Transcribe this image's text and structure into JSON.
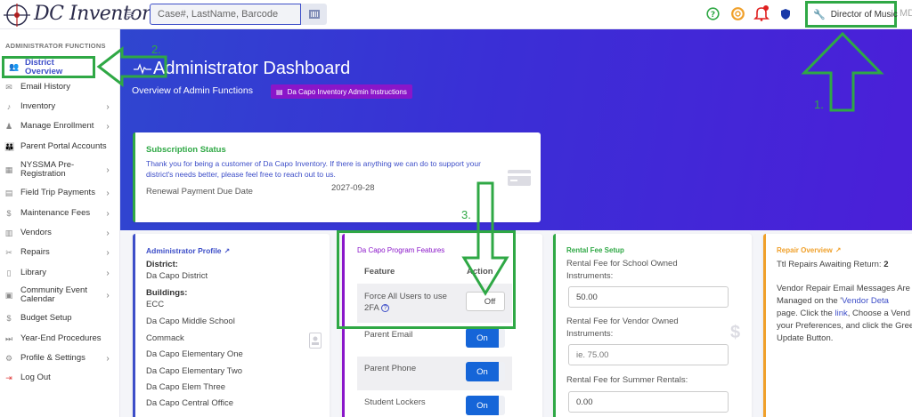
{
  "app": {
    "logo_text": "DC Inventory",
    "search_placeholder": "Case#, LastName, Barcode",
    "role": "Director of Music",
    "user_initials": "MD"
  },
  "sidebar": {
    "heading": "ADMINISTRATOR FUNCTIONS",
    "items": [
      {
        "label": "District Overview",
        "icon": "user-group-icon",
        "chevron": false,
        "active": true
      },
      {
        "label": "Email History",
        "icon": "envelope-icon",
        "chevron": false
      },
      {
        "label": "Inventory",
        "icon": "guitar-icon",
        "chevron": true
      },
      {
        "label": "Manage Enrollment",
        "icon": "user-tie-icon",
        "chevron": true
      },
      {
        "label": "Parent Portal Accounts",
        "icon": "users-icon",
        "chevron": false
      },
      {
        "label": "NYSSMA Pre-Registration",
        "icon": "building-icon",
        "chevron": true
      },
      {
        "label": "Field Trip Payments",
        "icon": "receipt-icon",
        "chevron": true
      },
      {
        "label": "Maintenance Fees",
        "icon": "dollar-icon",
        "chevron": true
      },
      {
        "label": "Vendors",
        "icon": "store-icon",
        "chevron": true
      },
      {
        "label": "Repairs",
        "icon": "tools-icon",
        "chevron": true
      },
      {
        "label": "Library",
        "icon": "book-icon",
        "chevron": true
      },
      {
        "label": "Community Event Calendar",
        "icon": "calendar-icon",
        "chevron": true
      },
      {
        "label": "Budget Setup",
        "icon": "dollar-icon",
        "chevron": false
      },
      {
        "label": "Year-End Procedures",
        "icon": "fast-forward-icon",
        "chevron": false
      },
      {
        "label": "Profile & Settings",
        "icon": "gear-icon",
        "chevron": true
      },
      {
        "label": "Log Out",
        "icon": "sign-out-icon",
        "chevron": false
      }
    ]
  },
  "header": {
    "title": "Administrator Dashboard",
    "subtitle": "Overview of Admin Functions",
    "instructions_button": "Da Capo Inventory Admin Instructions"
  },
  "subscription": {
    "title": "Subscription Status",
    "message": "Thank you for being a customer of Da Capo Inventory. If there is anything we can do to support your district's needs better, please feel free to reach out to us.",
    "due_label": "Renewal Payment Due Date",
    "due_value": "2027-09-28"
  },
  "profile": {
    "title": "Administrator Profile",
    "district_label": "District:",
    "district": "Da Capo District",
    "buildings_label": "Buildings:",
    "buildings": [
      "ECC",
      "Da Capo Middle School",
      "Commack",
      "Da Capo Elementary One",
      "Da Capo Elementary Two",
      "Da Capo Elem Three",
      "Da Capo Central Office"
    ]
  },
  "features": {
    "title": "Da Capo Program Features",
    "col_feature": "Feature",
    "col_action": "Action",
    "rows": [
      {
        "name": "Force All Users to use 2FA",
        "state": "Off",
        "help": "?"
      },
      {
        "name": "Parent Email",
        "state": "On"
      },
      {
        "name": "Parent Phone",
        "state": "On"
      },
      {
        "name": "Student Lockers",
        "state": "On"
      }
    ]
  },
  "rental": {
    "title": "Rental Fee Setup",
    "school_label": "Rental Fee for School Owned Instruments:",
    "school_value": "50.00",
    "vendor_label": "Rental Fee for Vendor Owned Instruments:",
    "vendor_placeholder": "ie. 75.00",
    "summer_label": "Rental Fee for Summer Rentals:",
    "summer_value": "0.00"
  },
  "repair": {
    "title": "Repair Overview",
    "awaiting_label": "Ttl Repairs Awaiting Return:",
    "awaiting_value": "2",
    "text_1": "Vendor Repair Email Messages Are Now Managed on the '",
    "link_1": "Vendor Deta",
    "text_2": "page. Click the ",
    "link_2": "link",
    "text_3": ", Choose a Vend Update your Preferences, and click the Green Update Button."
  },
  "annotations": {
    "n1": "1.",
    "n2": "2.",
    "n3": "3.",
    "color": "#2fa845"
  },
  "colors": {
    "primary": "#3d4ec8",
    "success": "#2fa845",
    "purple": "#8a16c9",
    "warning": "#f0a02a",
    "toggle_on": "#1565d8"
  }
}
